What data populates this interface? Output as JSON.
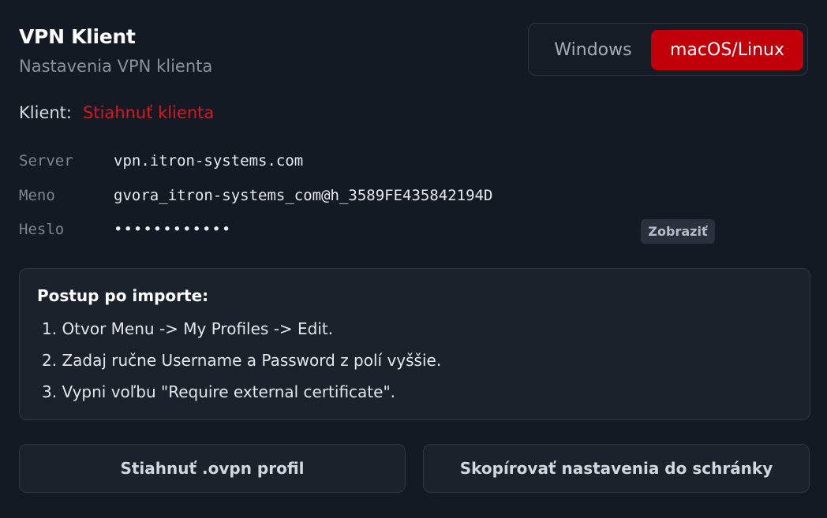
{
  "header": {
    "title": "VPN Klient",
    "subtitle": "Nastavenia VPN klienta"
  },
  "os_toggle": {
    "windows_label": "Windows",
    "macos_label": "macOS/Linux",
    "selected": "macOS/Linux"
  },
  "client": {
    "label": "Klient:",
    "link_text": "Stiahnuť klienta"
  },
  "config": {
    "server_label": "Server",
    "server_value": "vpn.itron-systems.com",
    "name_label": "Meno",
    "name_value": "gvora_itron-systems_com@h_3589FE435842194D",
    "password_label": "Heslo",
    "password_value": "••••••••••••",
    "show_label": "Zobraziť"
  },
  "instructions": {
    "title": "Postup po importe:",
    "steps": [
      "1. Otvor Menu -> My Profiles -> Edit.",
      "2. Zadaj ručne Username a Password z polí vyššie.",
      "3. Vypni voľbu \"Require external certificate\"."
    ]
  },
  "actions": {
    "download_label": "Stiahnuť .ovpn profil",
    "copy_label": "Skopírovať nastavenia do schránky"
  },
  "colors": {
    "background": "#141a23",
    "accent": "#c1000a",
    "link": "#e0141e"
  }
}
